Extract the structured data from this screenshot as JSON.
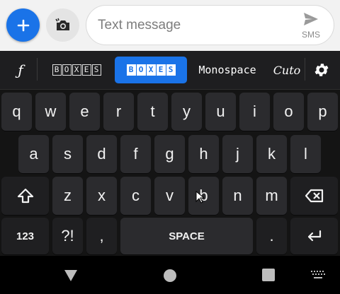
{
  "compose": {
    "add_icon": "plus-icon",
    "camera_icon": "camera-icon",
    "message_placeholder": "Text message",
    "send_icon": "send-icon",
    "send_label": "SMS"
  },
  "stylebar": {
    "fx_label": "ƒ",
    "style1_letters": [
      "B",
      "O",
      "X",
      "E",
      "S"
    ],
    "style2_letters": [
      "B",
      "O",
      "X",
      "E",
      "S"
    ],
    "style3_label": "Monospace",
    "style4_label": "Cuto",
    "settings_icon": "gear-icon"
  },
  "keys": {
    "row1": [
      "q",
      "w",
      "e",
      "r",
      "t",
      "y",
      "u",
      "i",
      "o",
      "p"
    ],
    "row2": [
      "a",
      "s",
      "d",
      "f",
      "g",
      "h",
      "j",
      "k",
      "l"
    ],
    "row3": [
      "z",
      "x",
      "c",
      "v",
      "b",
      "n",
      "m"
    ],
    "num_label": "123",
    "punct_label": "?!",
    "comma_label": ",",
    "space_label": "SPACE",
    "period_label": ".",
    "shift_icon": "shift-icon",
    "backspace_icon": "backspace-icon",
    "enter_icon": "enter-icon"
  },
  "nav": {
    "back_icon": "back-triangle-icon",
    "home_icon": "home-circle-icon",
    "recents_icon": "recents-square-icon",
    "keyboard_icon": "keyboard-icon"
  },
  "colors": {
    "accent": "#1a73e8",
    "keyboard_bg": "#141414",
    "key_bg": "#2b2b2e"
  }
}
